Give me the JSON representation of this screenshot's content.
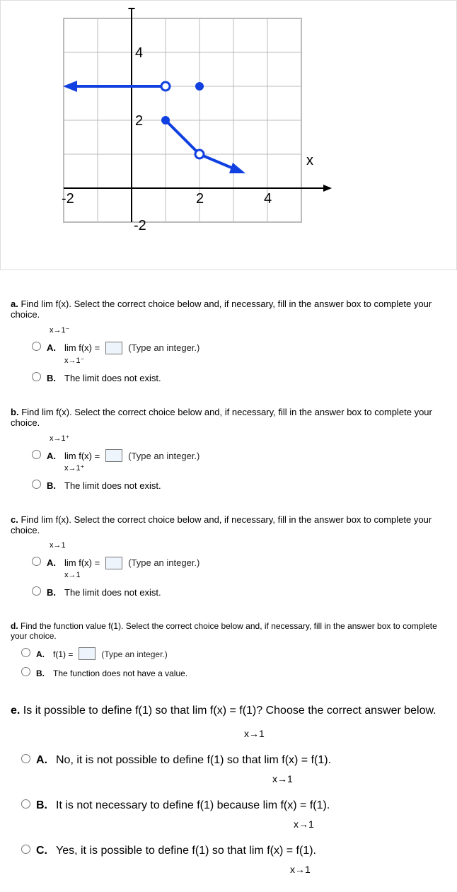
{
  "chart_data": {
    "type": "line",
    "title": "",
    "xlabel": "x",
    "ylabel": "",
    "xlim": [
      -3,
      5
    ],
    "ylim": [
      -3,
      5
    ],
    "gridlines": true,
    "ticks_x": [
      -2,
      2,
      4
    ],
    "ticks_y": [
      -2,
      2,
      4
    ],
    "segments": [
      {
        "kind": "ray_left_arrow",
        "from": [
          -3,
          3
        ],
        "to": [
          1,
          3
        ],
        "end_open": true
      },
      {
        "kind": "segment",
        "from": [
          1,
          2
        ],
        "to": [
          2,
          1
        ],
        "start_closed": true,
        "end_open": true
      },
      {
        "kind": "ray_right_arrow",
        "from": [
          2,
          1
        ],
        "to": [
          3,
          0
        ],
        "end_arrow": true
      }
    ],
    "points": [
      {
        "x": 1,
        "y": 3,
        "filled": false
      },
      {
        "x": 1,
        "y": 2,
        "filled": true
      },
      {
        "x": 2,
        "y": 1,
        "filled": false
      },
      {
        "x": 2,
        "y": 3,
        "filled": true
      }
    ],
    "axis_label_x": "x"
  },
  "qa": {
    "prompt": "Find  lim  f(x). Select the correct choice below and, if necessary, fill in the answer box to complete your choice.",
    "sub": "x→1⁻",
    "optA_pre": "lim  f(x) =",
    "optA_sub": "x→1⁻",
    "hint": "(Type an integer.)",
    "optB": "The limit does not exist."
  },
  "qb": {
    "prompt": "Find  lim  f(x). Select the correct choice below and, if necessary, fill in the answer box to complete your choice.",
    "sub": "x→1⁺",
    "optA_pre": "lim  f(x) =",
    "optA_sub": "x→1⁺",
    "hint": "(Type an integer.)",
    "optB": "The limit does not exist."
  },
  "qc": {
    "prompt": "Find  lim  f(x). Select the correct choice below and, if necessary, fill in the answer box to complete your choice.",
    "sub": "x→1",
    "optA_pre": "lim  f(x) =",
    "optA_sub": "x→1",
    "hint": "(Type an integer.)",
    "optB": "The limit does not exist."
  },
  "qd": {
    "prompt": "Find the function value f(1). Select the correct choice below and, if necessary, fill in the answer box to complete your choice.",
    "optA_pre": "f(1) =",
    "hint": "(Type an integer.)",
    "optB": "The function does not have a value."
  },
  "qe": {
    "prompt": "Is it possible to define f(1) so that  lim  f(x) = f(1)? Choose the correct answer below.",
    "sub": "x→1",
    "optA": "No, it is not possible to define f(1) so that  lim  f(x) = f(1).",
    "optA_sub": "x→1",
    "optB": "It is not necessary to define f(1) because  lim  f(x) = f(1).",
    "optB_sub": "x→1",
    "optC": "Yes, it is possible to define f(1) so that  lim  f(x) = f(1).",
    "optC_sub": "x→1"
  },
  "labels": {
    "A": "A.",
    "B": "B.",
    "C": "C.",
    "a": "a.",
    "b": "b.",
    "c": "c.",
    "d": "d.",
    "e": "e."
  }
}
